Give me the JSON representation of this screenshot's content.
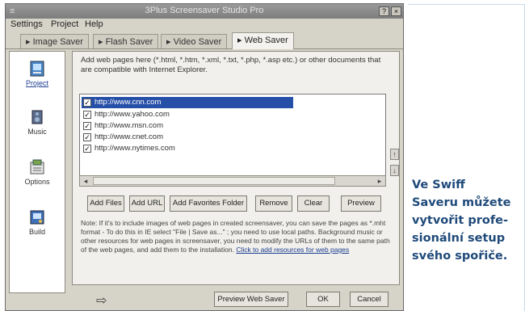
{
  "window": {
    "title": "3Plus Screensaver Studio Pro",
    "help_button": "?",
    "close_button": "×",
    "system_icon": "≡"
  },
  "menu": [
    "Settings",
    "Project",
    "Help"
  ],
  "tabs": [
    {
      "label": "Image Saver",
      "active": false
    },
    {
      "label": "Flash Saver",
      "active": false
    },
    {
      "label": "Video Saver",
      "active": false
    },
    {
      "label": "Web Saver",
      "active": true
    }
  ],
  "sidebar": [
    {
      "label": "Project",
      "icon": "project-icon",
      "active": true
    },
    {
      "label": "Music",
      "icon": "music-icon",
      "active": false
    },
    {
      "label": "Options",
      "icon": "options-icon",
      "active": false
    },
    {
      "label": "Build",
      "icon": "build-icon",
      "active": false
    }
  ],
  "panel": {
    "description": "Add web pages here (*.html, *.htm, *.xml, *.txt, *.php, *.asp etc.) or other documents that are compatible with Internet Explorer.",
    "urls": [
      {
        "url": "http://www.cnn.com",
        "checked": true,
        "selected": true
      },
      {
        "url": "http://www.yahoo.com",
        "checked": true,
        "selected": false
      },
      {
        "url": "http://www.msn.com",
        "checked": true,
        "selected": false
      },
      {
        "url": "http://www.cnet.com",
        "checked": true,
        "selected": false
      },
      {
        "url": "http://www.nytimes.com",
        "checked": true,
        "selected": false
      }
    ],
    "buttons": {
      "add_files": "Add Files",
      "add_url": "Add URL",
      "add_favorites": "Add Favorites Folder",
      "remove": "Remove",
      "clear": "Clear",
      "preview": "Preview"
    },
    "note": "Note: If it's to include images of web pages in created screensaver, you can save the pages as *.mht format - To do this in IE select \"File | Save as...\" ; you need to use local paths. Background music or other resources for web pages in screensaver, you need to modify the URLs of them to the same path of the web pages, and add them to the installation.",
    "note_link": "Click to add resources for web pages",
    "move_up": "↑",
    "move_down": "↓"
  },
  "bottom": {
    "preview_button": "Preview Web Saver",
    "ok_button": "OK",
    "cancel_button": "Cancel",
    "arrow_icon": "⇨"
  },
  "caption": [
    "Ve Swiff",
    "Saveru můžete",
    "vytvořit profe-",
    "sionální setup",
    "svého spořiče."
  ],
  "colors": {
    "selection": "#264fa8",
    "caption": "#1f4a7a",
    "window_bg": "#d6d3c8"
  }
}
